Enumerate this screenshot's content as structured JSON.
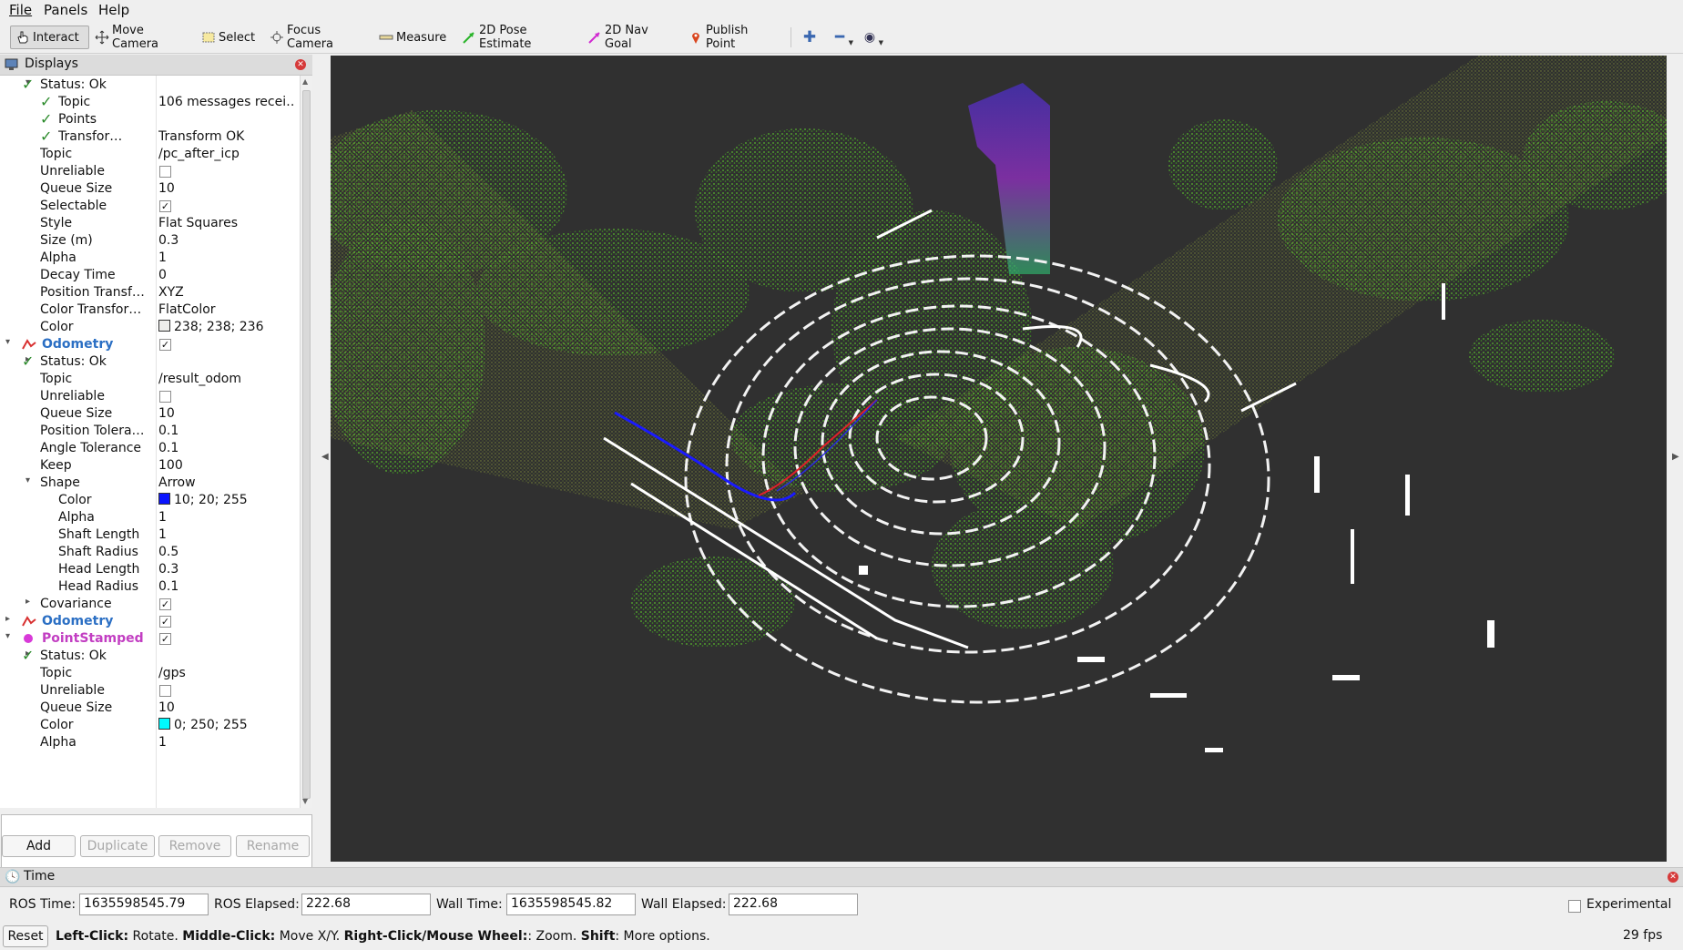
{
  "menu": [
    "File",
    "Panels",
    "Help"
  ],
  "toolbar": {
    "interact": "Interact",
    "move_camera": "Move Camera",
    "select": "Select",
    "focus_camera": "Focus Camera",
    "measure": "Measure",
    "pose_estimate": "2D Pose Estimate",
    "nav_goal": "2D Nav Goal",
    "publish_point": "Publish Point"
  },
  "displays": {
    "title": "Displays",
    "rows": [
      {
        "prop": "Status: Ok",
        "arrow": "down",
        "check": true,
        "indent": 1
      },
      {
        "prop": "Topic",
        "val": "106 messages recei…",
        "check": true,
        "indent": 2
      },
      {
        "prop": "Points",
        "check": true,
        "indent": 2
      },
      {
        "prop": "Transfor…",
        "val": "Transform OK",
        "check": true,
        "indent": 2
      },
      {
        "prop": "Topic",
        "val": "/pc_after_icp",
        "indent": 1
      },
      {
        "prop": "Unreliable",
        "cb": false,
        "indent": 1
      },
      {
        "prop": "Queue Size",
        "val": "10",
        "indent": 1
      },
      {
        "prop": "Selectable",
        "cb": true,
        "indent": 1
      },
      {
        "prop": "Style",
        "val": "Flat Squares",
        "indent": 1
      },
      {
        "prop": "Size (m)",
        "val": "0.3",
        "indent": 1
      },
      {
        "prop": "Alpha",
        "val": "1",
        "indent": 1
      },
      {
        "prop": "Decay Time",
        "val": "0",
        "indent": 1
      },
      {
        "prop": "Position Transf…",
        "val": "XYZ",
        "indent": 1
      },
      {
        "prop": "Color Transfor…",
        "val": "FlatColor",
        "indent": 1
      },
      {
        "prop": "Color",
        "val": "238; 238; 236",
        "swatch": "#eeeeec",
        "indent": 1
      },
      {
        "prop": "Odometry",
        "display": "odom",
        "arrow": "down",
        "cb": true,
        "indent": 0
      },
      {
        "prop": "Status: Ok",
        "arrow": "right",
        "check": true,
        "indent": 1
      },
      {
        "prop": "Topic",
        "val": "/result_odom",
        "indent": 1
      },
      {
        "prop": "Unreliable",
        "cb": false,
        "indent": 1
      },
      {
        "prop": "Queue Size",
        "val": "10",
        "indent": 1
      },
      {
        "prop": "Position Tolera…",
        "val": "0.1",
        "indent": 1
      },
      {
        "prop": "Angle Tolerance",
        "val": "0.1",
        "indent": 1
      },
      {
        "prop": "Keep",
        "val": "100",
        "indent": 1
      },
      {
        "prop": "Shape",
        "val": "Arrow",
        "arrow": "down",
        "indent": 1
      },
      {
        "prop": "Color",
        "val": "10; 20; 255",
        "swatch": "#0a14ff",
        "indent": 2
      },
      {
        "prop": "Alpha",
        "val": "1",
        "indent": 2
      },
      {
        "prop": "Shaft Length",
        "val": "1",
        "indent": 2
      },
      {
        "prop": "Shaft Radius",
        "val": "0.5",
        "indent": 2
      },
      {
        "prop": "Head Length",
        "val": "0.3",
        "indent": 2
      },
      {
        "prop": "Head Radius",
        "val": "0.1",
        "indent": 2
      },
      {
        "prop": "Covariance",
        "arrow": "right",
        "cb": true,
        "indent": 1
      },
      {
        "prop": "Odometry",
        "display": "odom",
        "arrow": "right",
        "cb": true,
        "indent": 0
      },
      {
        "prop": "PointStamped",
        "display": "point",
        "arrow": "down",
        "cb": true,
        "indent": 0
      },
      {
        "prop": "Status: Ok",
        "arrow": "right",
        "check": true,
        "indent": 1
      },
      {
        "prop": "Topic",
        "val": "/gps",
        "indent": 1
      },
      {
        "prop": "Unreliable",
        "cb": false,
        "indent": 1
      },
      {
        "prop": "Queue Size",
        "val": "10",
        "indent": 1
      },
      {
        "prop": "Color",
        "val": "0; 250; 255",
        "swatch": "#00faff",
        "indent": 1
      },
      {
        "prop": "Alpha",
        "val": "1",
        "indent": 1
      }
    ]
  },
  "buttons": {
    "add": "Add",
    "duplicate": "Duplicate",
    "remove": "Remove",
    "rename": "Rename"
  },
  "time": {
    "title": "Time",
    "ros_time_label": "ROS Time:",
    "ros_time": "1635598545.79",
    "ros_elapsed_label": "ROS Elapsed:",
    "ros_elapsed": "222.68",
    "wall_time_label": "Wall Time:",
    "wall_time": "1635598545.82",
    "wall_elapsed_label": "Wall Elapsed:",
    "wall_elapsed": "222.68",
    "experimental": "Experimental"
  },
  "status": {
    "reset": "Reset",
    "hint_lc": "Left-Click:",
    "hint_lc_txt": " Rotate. ",
    "hint_mc": "Middle-Click:",
    "hint_mc_txt": " Move X/Y. ",
    "hint_rc": "Right-Click/Mouse Wheel:",
    "hint_rc_txt": ": Zoom. ",
    "hint_sh": "Shift",
    "hint_sh_txt": ": More options.",
    "fps": "29 fps"
  },
  "colors": {
    "viewport_bg": "#303030",
    "path_blue": "#1a1aff",
    "path_red": "#e0202a",
    "vegetation": "#4caf2a",
    "structure": "#ffffff"
  }
}
